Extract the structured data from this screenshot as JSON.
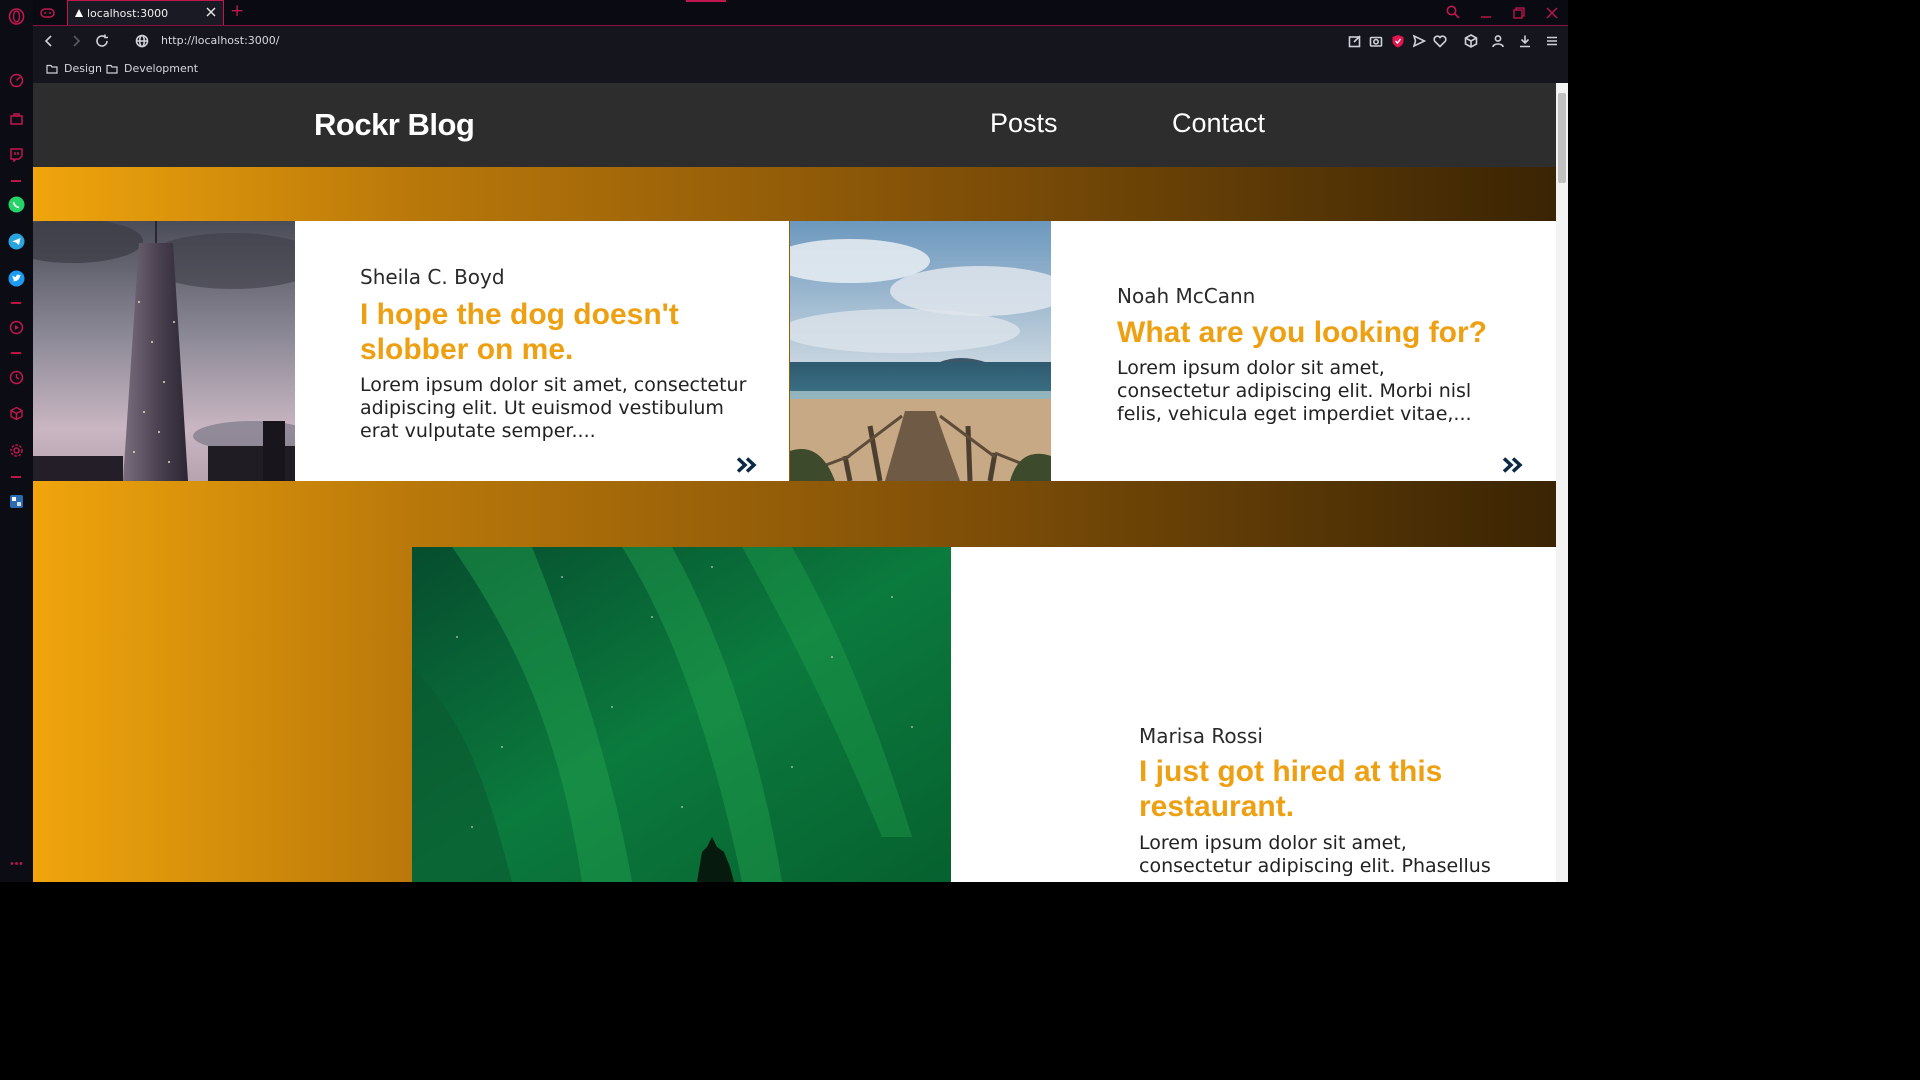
{
  "browser": {
    "tab_title": "localhost:3000",
    "url": "http://localhost:3000/",
    "bookmarks": [
      "Design",
      "Development"
    ],
    "new_tab_label": "+"
  },
  "site": {
    "brand": "Rockr Blog",
    "nav": [
      "Posts",
      "Contact"
    ]
  },
  "posts": [
    {
      "author": "Sheila C. Boyd",
      "title": "I hope the dog doesn't slobber on me.",
      "excerpt": "Lorem ipsum dolor sit amet, consectetur adipiscing elit. Ut euismod vestibulum erat vulputate semper....",
      "image": "skyscraper-photo"
    },
    {
      "author": "Noah McCann",
      "title": "What are you looking for?",
      "excerpt": "Lorem ipsum dolor sit amet, consectetur adipiscing elit. Morbi nisl felis, vehicula eget imperdiet vitae,...",
      "image": "beach-photo"
    },
    {
      "author": "Marisa Rossi",
      "title": "I just got hired at this restaurant.",
      "excerpt": "Lorem ipsum dolor sit amet, consectetur adipiscing elit. Phasellus",
      "image": "aurora-photo"
    }
  ],
  "colors": {
    "accent": "#eea013",
    "nav_bg": "#2d2d2d",
    "arrow": "#0b2a45",
    "browser_accent": "#c0174f"
  }
}
